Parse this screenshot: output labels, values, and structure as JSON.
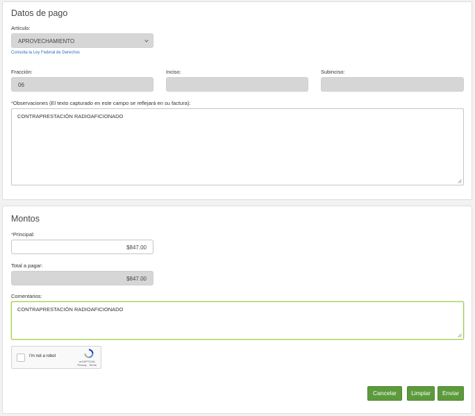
{
  "datos_pago": {
    "title": "Datos de pago",
    "articulo_label": "Artículo:",
    "articulo_value": "APROVECHAMIENTO",
    "consulta_link": "Consulta la Ley Federal de Derechos",
    "fraccion_label": "Fracción:",
    "fraccion_value": "06",
    "inciso_label": "Inciso:",
    "inciso_value": "",
    "subinciso_label": "Subinciso:",
    "subinciso_value": "",
    "required_mark": "*",
    "observaciones_label": "Observaciones (El texto capturado en este campo se reflejará en su factura):",
    "observaciones_value": "CONTRAPRESTACIÓN RADIOAFICIONADO"
  },
  "montos": {
    "title": "Montos",
    "required_mark": "*",
    "principal_label": "Principal:",
    "principal_value": "$847.00",
    "total_label": "Total a pagar:",
    "total_value": "$847.00",
    "comentarios_label": "Comentarios:",
    "comentarios_value": "CONTRAPRESTACIÓN RADIOAFICIONADO"
  },
  "captcha": {
    "label": "I'm not a robot",
    "brand": "reCAPTCHA",
    "links": "Privacy - Terms"
  },
  "buttons": {
    "cancelar": "Cancelar",
    "limpiar": "Limpiar",
    "enviar": "Enviar"
  },
  "colors": {
    "button_green": "#5c9a3c",
    "link_blue": "#2a6fb5",
    "required_red": "#c0392b",
    "focus_border": "#9ccc4a"
  }
}
